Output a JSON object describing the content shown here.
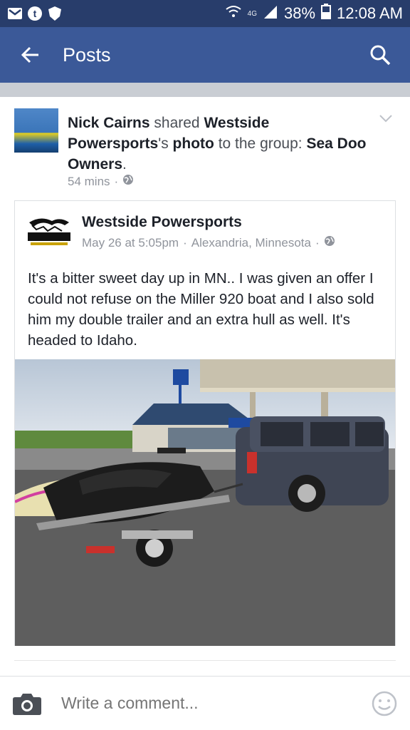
{
  "status": {
    "network": "4G",
    "battery": "38%",
    "time": "12:08 AM"
  },
  "appbar": {
    "title": "Posts"
  },
  "post": {
    "author": "Nick Cairns",
    "verb": " shared ",
    "page": "Westside Powersports",
    "possessive": "'s ",
    "object": "photo",
    "to_group": " to the group: ",
    "group": "Sea Doo Owners",
    "period": ".",
    "time": "54 mins",
    "sep": "·"
  },
  "shared": {
    "name": "Westside Powersports",
    "date": "May 26 at 5:05pm",
    "sep": "·",
    "location": "Alexandria, Minnesota",
    "text": "It's a bitter sweet day up in MN.. I was given an offer I could not refuse on the Miller 920 boat and I also sold him my double trailer and an extra hull as well. It's headed to Idaho.",
    "logo_text": "Westside"
  },
  "composer": {
    "placeholder": "Write a comment..."
  },
  "colors": {
    "brand": "#3b5998",
    "statusbar": "#283d6b",
    "meta": "#90949c"
  }
}
